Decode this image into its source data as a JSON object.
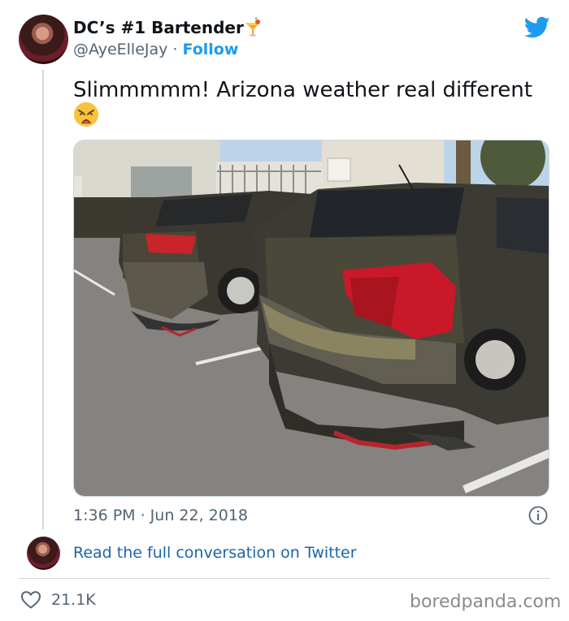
{
  "tweet": {
    "author_name": "DC’s #1 Bartender",
    "handle": "@AyeElleJay",
    "separator": " · ",
    "follow_label": "Follow",
    "text": "Slimmmmm! Arizona weather real different",
    "emoji": "weary-face-emoji",
    "name_emoji": "tropical-drink-emoji",
    "timestamp": "1:36 PM · Jun 22, 2018",
    "read_link": "Read the full conversation on Twitter",
    "like_count": "21.1K"
  },
  "watermark": "boredpanda.com",
  "colors": {
    "link": "#1d9bf0",
    "read_link": "#1d64ab",
    "text": "#0f1419",
    "muted": "#536471",
    "border": "#cfd9de"
  }
}
